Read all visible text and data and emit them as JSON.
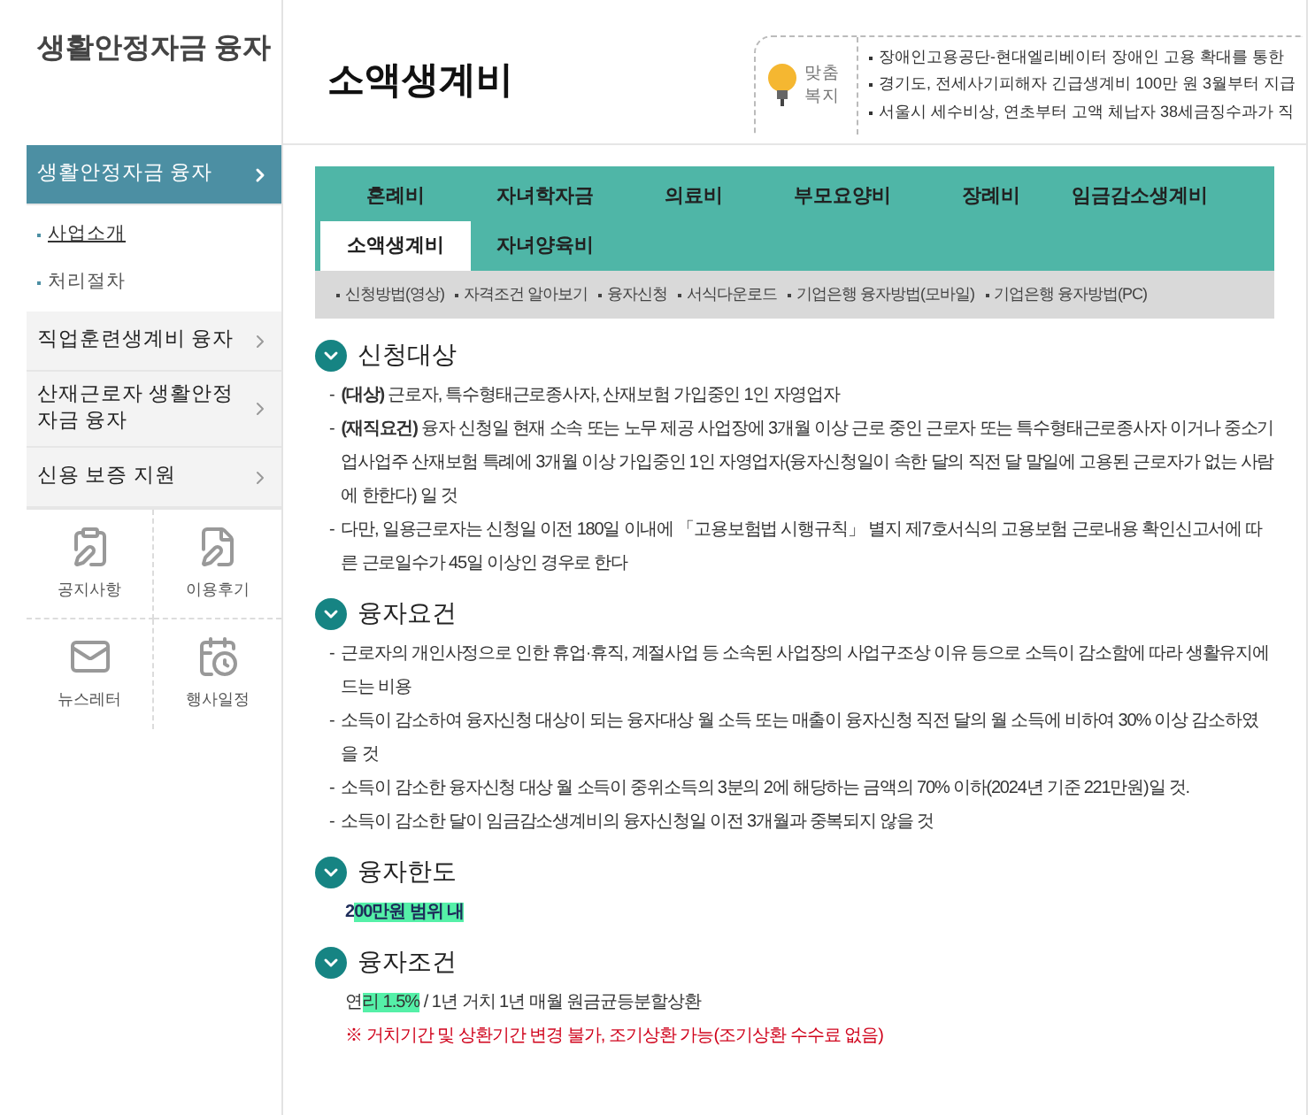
{
  "sidebar": {
    "title": "생활안정자금 융자",
    "menu": [
      {
        "label": "생활안정자금 융자",
        "selected": true,
        "children": [
          {
            "label": "사업소개",
            "selected": true
          },
          {
            "label": "처리절차",
            "selected": false
          }
        ]
      },
      {
        "label": "직업훈련생계비 융자",
        "selected": false
      },
      {
        "label": "산재근로자 생활안정자금 융자",
        "selected": false
      },
      {
        "label": "신용 보증 지원",
        "selected": false
      }
    ],
    "quick_links": [
      {
        "label": "공지사항",
        "kind": "notice"
      },
      {
        "label": "이용후기",
        "kind": "review"
      },
      {
        "label": "뉴스레터",
        "kind": "newsletter"
      },
      {
        "label": "행사일정",
        "kind": "calendar"
      }
    ]
  },
  "header": {
    "title": "소액생계비",
    "promo": {
      "label": "맞춤 복지",
      "items": [
        "장애인고용공단-현대엘리베이터 장애인 고용 확대를 통한",
        "경기도, 전세사기피해자 긴급생계비 100만 원 3월부터 지급",
        "서울시 세수비상, 연초부터 고액 체납자 38세금징수과가 직"
      ]
    }
  },
  "tab_rows": [
    [
      {
        "label": "혼례비",
        "selected": false
      },
      {
        "label": "자녀학자금",
        "selected": false
      },
      {
        "label": "의료비",
        "selected": false
      },
      {
        "label": "부모요양비",
        "selected": false
      },
      {
        "label": "장례비",
        "selected": false
      },
      {
        "label": "임금감소생계비",
        "selected": false
      }
    ],
    [
      {
        "label": "소액생계비",
        "selected": true
      },
      {
        "label": "자녀양육비",
        "selected": false
      }
    ]
  ],
  "sub_links": [
    "신청방법(영상)",
    "자격조건 알아보기",
    "융자신청",
    "서식다운로드",
    "기업은행 융자방법(모바일)",
    "기업은행 융자방법(PC)"
  ],
  "sections": [
    {
      "title": "신청대상",
      "kind": "list",
      "marker": "-",
      "items": [
        "**(대상)** 근로자, 특수형태근로종사자, 산재보험 가입중인 1인 자영업자",
        "**(재직요건)** 융자 신청일 현재 소속 또는 노무 제공 사업장에 3개월 이상 근로 중인 근로자 또는 특수형태근로종사자 이거나 중소기업사업주 산재보험 특례에 3개월 이상 가입중인 1인 자영업자(융자신청일이 속한 달의 직전 달 말일에 고용된 근로자가 없는 사람에 한한다) 일 것",
        "다만, 일용근로자는 신청일 이전 180일 이내에 「고용보험법 시행규칙」 별지 제7호서식의 고용보험 근로내용 확인신고서에 따른 근로일수가 45일 이상인 경우로 한다"
      ]
    },
    {
      "title": "융자요건",
      "kind": "list",
      "marker": "-",
      "items": [
        "근로자의 개인사정으로 인한 휴업·휴직, 계절사업 등 소속된 사업장의 사업구조상 이유 등으로 소득이 감소함에 따라 생활유지에 드는 비용",
        "소득이 감소하여 융자신청 대상이 되는 융자대상 월 소득 또는 매출이 융자신청 직전 달의 월 소득에 비하여 30% 이상 감소하였을 것",
        "소득이 감소한 융자신청 대상 월 소득이 중위소득의 3분의 2에 해당하는 금액의 70% 이하(2024년 기준 221만원)일 것.",
        "소득이 감소한 달이 임금감소생계비의 융자신청일 이전 3개월과 중복되지 않을 것"
      ]
    },
    {
      "title": "융자한도",
      "kind": "lines",
      "lines": [
        {
          "kind": "strong",
          "parts": [
            {
              "text": "2",
              "highlight": false
            },
            {
              "text": "00만원 범위 내",
              "highlight": true
            }
          ]
        }
      ]
    },
    {
      "title": "융자조건",
      "kind": "lines",
      "lines": [
        {
          "kind": "plain",
          "parts": [
            {
              "text": "연",
              "highlight": false
            },
            {
              "text": "리 1.5%",
              "highlight": true
            },
            {
              "text": " / 1년 거치 1년 매월 원금균등분할상환",
              "highlight": false
            }
          ]
        },
        {
          "kind": "note",
          "parts": [
            {
              "text": "※ 거치기간 및 상환기간 변경 불가, 조기상환 가능(조기상환 수수료 없음)",
              "highlight": false
            }
          ]
        }
      ]
    }
  ]
}
